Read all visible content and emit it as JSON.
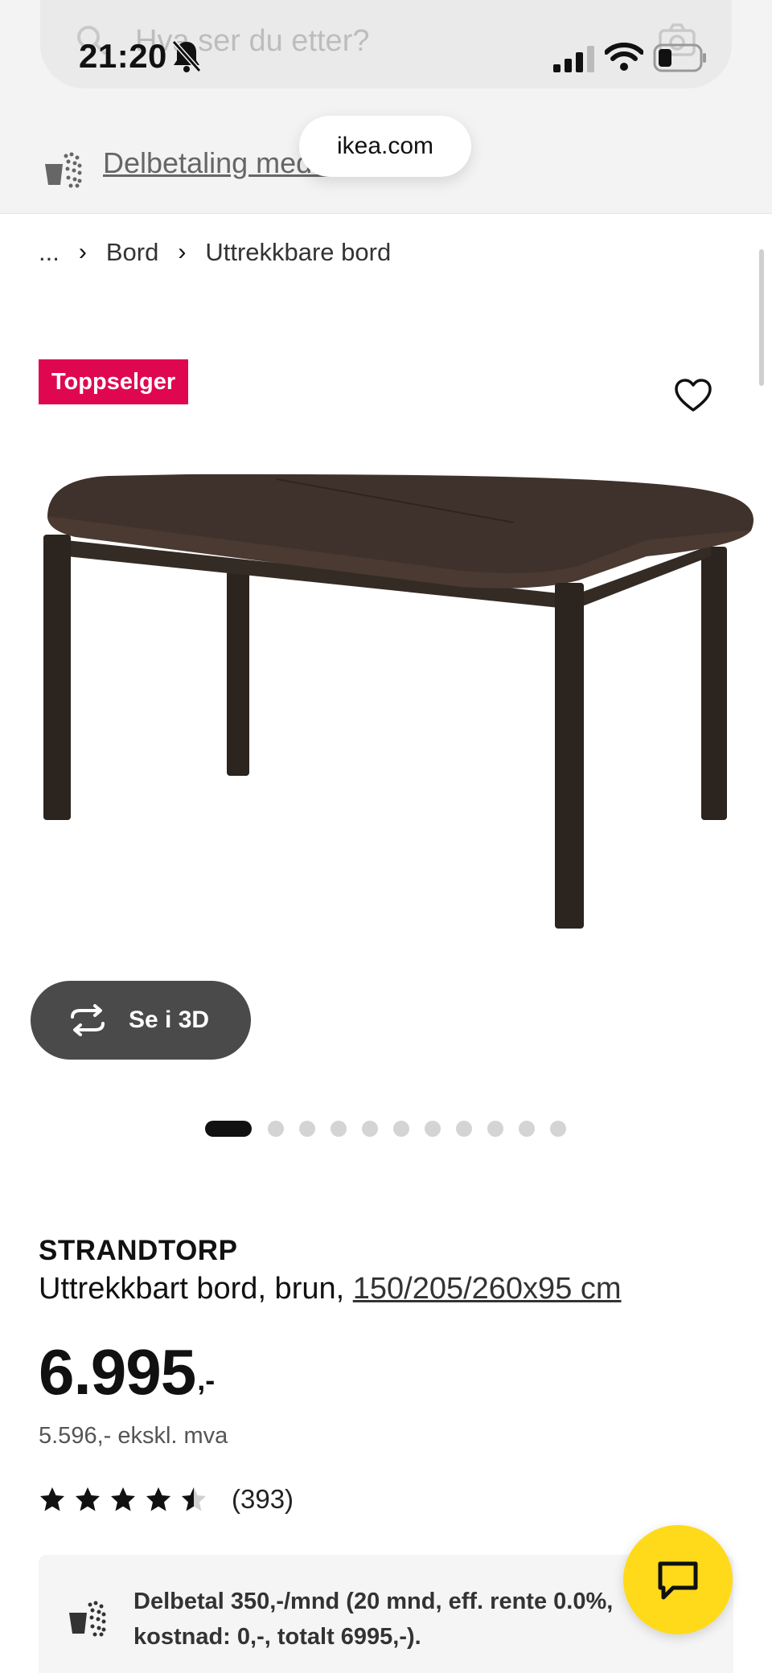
{
  "status_bar": {
    "time": "21:20"
  },
  "search": {
    "placeholder": "Hva ser du etter?"
  },
  "banner": {
    "installment_link": "Delbetaling med 0 i rente"
  },
  "browser": {
    "url": "ikea.com"
  },
  "breadcrumb": {
    "items": [
      "...",
      "Bord",
      "Uttrekkbare bord"
    ]
  },
  "product": {
    "badge": "Toppselger",
    "view_3d_label": "Se i 3D",
    "gallery": {
      "image_count": 11,
      "active_index": 0
    },
    "name": "STRANDTORP",
    "description": "Uttrekkbart bord, brun, ",
    "dimensions": "150/205/260x95 cm",
    "price": "6.995",
    "price_suffix": ",-",
    "price_ex_vat": "5.596,- ekskl. mva",
    "rating": 4.5,
    "review_count": "(393)",
    "installment_info": "Delbetal 350,-/mnd (20 mnd, eff. rente 0.0%, kostnad: 0,-, totalt 6995,-)."
  },
  "colors": {
    "badge": "#e00751",
    "chat_button": "#ffda1a",
    "view_3d_button": "#4a4a4a"
  },
  "icons": [
    "search-icon",
    "camera-icon",
    "mute-icon",
    "signal-icon",
    "wifi-icon",
    "battery-icon",
    "installment-icon",
    "heart-icon",
    "rotate-3d-icon",
    "star-icon",
    "chat-icon"
  ]
}
